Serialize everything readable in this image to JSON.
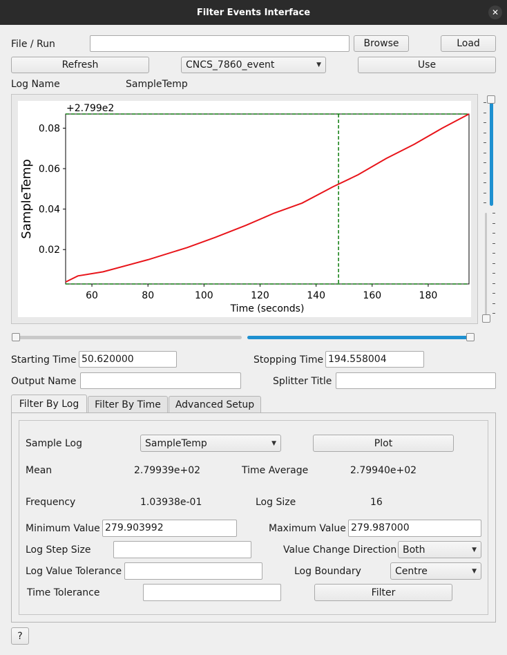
{
  "window": {
    "title": "Filter Events Interface"
  },
  "file_run": {
    "label": "File / Run",
    "value": "",
    "browse_label": "Browse",
    "load_label": "Load"
  },
  "workspace": {
    "refresh_label": "Refresh",
    "selected": "CNCS_7860_event",
    "use_label": "Use"
  },
  "log_name": {
    "label": "Log Name",
    "value": "SampleTemp"
  },
  "chart_data": {
    "type": "line",
    "offset_label": "+2.799e2",
    "xlabel": "Time (seconds)",
    "ylabel": "SampleTemp",
    "xlim": [
      50.62,
      194.56
    ],
    "ylim": [
      0.003,
      0.087
    ],
    "xticks": [
      "60",
      "80",
      "100",
      "120",
      "140",
      "160",
      "180"
    ],
    "xtick_values": [
      60,
      80,
      100,
      120,
      140,
      160,
      180
    ],
    "yticks": [
      "0.02",
      "0.04",
      "0.06",
      "0.08"
    ],
    "ytick_values": [
      0.02,
      0.04,
      0.06,
      0.08
    ],
    "x": [
      50.62,
      55,
      64,
      80,
      94,
      104,
      115,
      125,
      135,
      146,
      155,
      165,
      175,
      185,
      194.56
    ],
    "values": [
      0.004,
      0.007,
      0.009,
      0.015,
      0.021,
      0.026,
      0.032,
      0.038,
      0.043,
      0.051,
      0.057,
      0.065,
      0.072,
      0.08,
      0.087
    ],
    "series_color": "#e8141a",
    "marker_color": "#0b7a0b",
    "marker_vline_x": 148,
    "marker_hline_low": 0.003,
    "marker_hline_high": 0.087
  },
  "time": {
    "start_label": "Starting Time",
    "start_value": "50.620000",
    "stop_label": "Stopping Time",
    "stop_value": "194.558004"
  },
  "output": {
    "name_label": "Output Name",
    "name_value": "",
    "splitter_label": "Splitter Title",
    "splitter_value": ""
  },
  "tabs": [
    {
      "label": "Filter By Log",
      "active": true
    },
    {
      "label": "Filter By Time",
      "active": false
    },
    {
      "label": "Advanced Setup",
      "active": false
    }
  ],
  "filter_by_log": {
    "sample_log_label": "Sample Log",
    "sample_log_value": "SampleTemp",
    "plot_label": "Plot",
    "mean_label": "Mean",
    "mean_value": "2.79939e+02",
    "time_avg_label": "Time Average",
    "time_avg_value": "2.79940e+02",
    "frequency_label": "Frequency",
    "frequency_value": "1.03938e-01",
    "log_size_label": "Log Size",
    "log_size_value": "16",
    "min_label": "Minimum Value",
    "min_value": "279.903992",
    "max_label": "Maximum Value",
    "max_value": "279.987000",
    "step_label": "Log Step Size",
    "step_value": "",
    "direction_label": "Value Change Direction",
    "direction_value": "Both",
    "tolerance_label": "Log Value Tolerance",
    "tolerance_value": "",
    "boundary_label": "Log Boundary",
    "boundary_value": "Centre",
    "time_tol_label": "Time Tolerance",
    "time_tol_value": "",
    "filter_label": "Filter"
  },
  "help": {
    "label": "?"
  },
  "icons": {
    "close": "close-icon",
    "dropdown": "chevron-down-icon"
  },
  "colors": {
    "accent": "#1e90d0",
    "titlebar": "#2b2b2b"
  },
  "sliders": {
    "horizontal_low": 0,
    "horizontal_high": 1,
    "vertical_top": 1,
    "vertical_bottom": 0
  }
}
